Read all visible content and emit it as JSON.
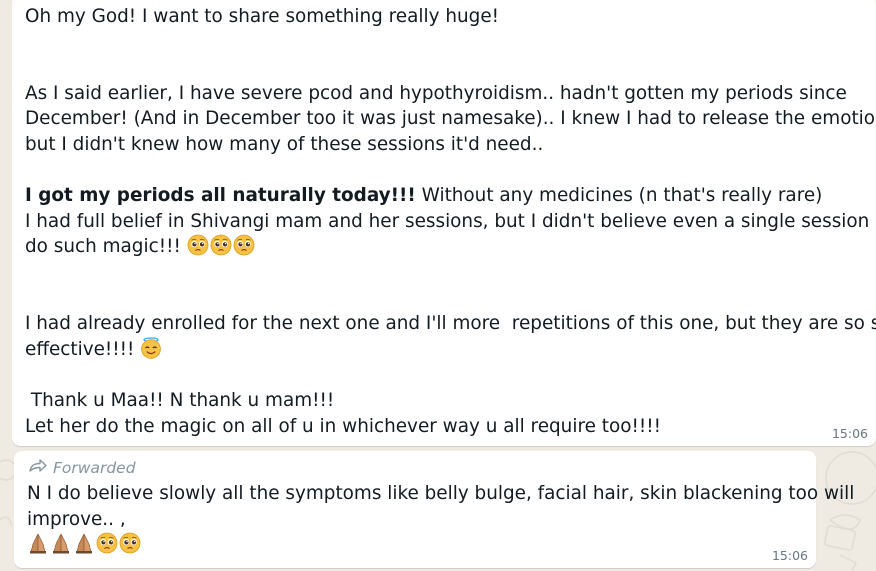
{
  "message_1": {
    "lines": [
      {
        "text": "Oh my God! I want to share something really huge!"
      },
      {
        "text": ""
      },
      {
        "text": ""
      },
      {
        "text": "As I said earlier, I have severe pcod and hypothyroidism.. hadn't gotten my periods since"
      },
      {
        "text": "December! (And in December too it was just namesake).. I knew I had to release the emotions,"
      },
      {
        "text": "but I didn't knew how many of these sessions it'd need.."
      },
      {
        "text": ""
      },
      {
        "bold": "I got my periods all naturally today!!!",
        "text": " Without any medicines (n that's really rare)"
      },
      {
        "text": "I had full belief in Shivangi mam and her sessions, but I didn't believe even a single session can"
      },
      {
        "text": "do such magic!!! ",
        "emojis": [
          "pleading-face",
          "pleading-face",
          "pleading-face"
        ]
      },
      {
        "text": ""
      },
      {
        "text": ""
      },
      {
        "text": "I had already enrolled for the next one and I'll more  repetitions of this one, but they are so so so"
      },
      {
        "text": "effective!!!! ",
        "emojis": [
          "smiling-face-with-halo"
        ]
      },
      {
        "text": ""
      },
      {
        "text": " Thank u Maa!! N thank u mam!!!"
      },
      {
        "text": "Let her do the magic on all of u in whichever way u all require too!!!!"
      }
    ],
    "time": "15:06"
  },
  "message_2": {
    "forwarded_label": "Forwarded",
    "forward_icon": "forward-arrow-icon",
    "lines": [
      {
        "text": "N I do believe slowly all the symptoms like belly bulge, facial hair, skin blackening too will"
      },
      {
        "text": "improve.. ,"
      },
      {
        "text": "",
        "emojis": [
          "folded-hands",
          "folded-hands",
          "folded-hands",
          "pleading-face",
          "pleading-face"
        ]
      }
    ],
    "time": "15:06"
  },
  "colors": {
    "chat_background": "#efeae2",
    "bubble": "#ffffff",
    "text": "#111b21",
    "meta": "#667781",
    "forwarded": "#8696a0"
  }
}
